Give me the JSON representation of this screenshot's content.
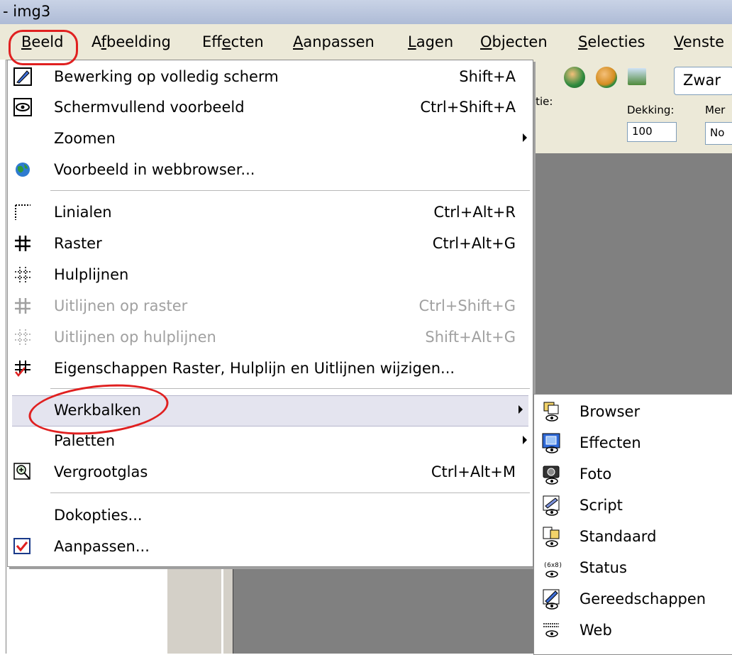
{
  "window": {
    "title": "- img3"
  },
  "menubar": {
    "items": [
      {
        "label": "Beeld"
      },
      {
        "label": "Afbeelding"
      },
      {
        "label": "Effecten"
      },
      {
        "label": "Aanpassen"
      },
      {
        "label": "Lagen"
      },
      {
        "label": "Objecten"
      },
      {
        "label": "Selecties"
      },
      {
        "label": "Venste"
      }
    ]
  },
  "toolbar": {
    "dropdown_value": "Zwar",
    "rotatie_label": "tatie:",
    "dekking_label": "Dekking:",
    "dekking_value": "100",
    "mengmodus_label": "Mer",
    "mengmodus_value": "No"
  },
  "main_menu": {
    "items": [
      {
        "label": "Bewerking op volledig scherm",
        "shortcut": "Shift+A",
        "icon": "fullscreen-edit-icon",
        "enabled": true
      },
      {
        "label": "Schermvullend voorbeeld",
        "shortcut": "Ctrl+Shift+A",
        "icon": "eye-preview-icon",
        "enabled": true
      },
      {
        "label": "Zoomen",
        "shortcut": "",
        "icon": "",
        "enabled": true,
        "submenu": true
      },
      {
        "label": "Voorbeeld in webbrowser...",
        "shortcut": "",
        "icon": "globe-icon",
        "enabled": true
      },
      {
        "label": "Linialen",
        "shortcut": "Ctrl+Alt+R",
        "icon": "ruler-icon",
        "enabled": true
      },
      {
        "label": "Raster",
        "shortcut": "Ctrl+Alt+G",
        "icon": "grid-icon",
        "enabled": true
      },
      {
        "label": "Hulplijnen",
        "shortcut": "",
        "icon": "guides-icon",
        "enabled": true
      },
      {
        "label": "Uitlijnen op raster",
        "shortcut": "Ctrl+Shift+G",
        "icon": "snap-grid-icon",
        "enabled": false
      },
      {
        "label": "Uitlijnen op hulplijnen",
        "shortcut": "Shift+Alt+G",
        "icon": "snap-guides-icon",
        "enabled": false
      },
      {
        "label": "Eigenschappen Raster, Hulplijn en Uitlijnen wijzigen...",
        "shortcut": "",
        "icon": "grid-properties-icon",
        "enabled": true
      },
      {
        "label": "Werkbalken",
        "shortcut": "",
        "icon": "",
        "enabled": true,
        "submenu": true
      },
      {
        "label": "Paletten",
        "shortcut": "",
        "icon": "",
        "enabled": true,
        "submenu": true
      },
      {
        "label": "Vergrootglas",
        "shortcut": "Ctrl+Alt+M",
        "icon": "magnifier-icon",
        "enabled": true
      },
      {
        "label": "Dokopties...",
        "shortcut": "",
        "icon": "",
        "enabled": true
      },
      {
        "label": "Aanpassen...",
        "shortcut": "",
        "icon": "checkmark-icon",
        "enabled": true
      }
    ]
  },
  "submenu": {
    "items": [
      {
        "label": "Browser",
        "icon": "browser-toolbar-icon"
      },
      {
        "label": "Effecten",
        "icon": "effects-toolbar-icon"
      },
      {
        "label": "Foto",
        "icon": "photo-toolbar-icon"
      },
      {
        "label": "Script",
        "icon": "script-toolbar-icon"
      },
      {
        "label": "Standaard",
        "icon": "standard-toolbar-icon"
      },
      {
        "label": "Status",
        "icon": "status-toolbar-icon"
      },
      {
        "label": "Gereedschappen",
        "icon": "tools-toolbar-icon"
      },
      {
        "label": "Web",
        "icon": "web-toolbar-icon"
      }
    ]
  },
  "colors": {
    "annotation": "#e02020",
    "menubar_bg": "#ece9d8",
    "canvas_bg": "#808080"
  }
}
